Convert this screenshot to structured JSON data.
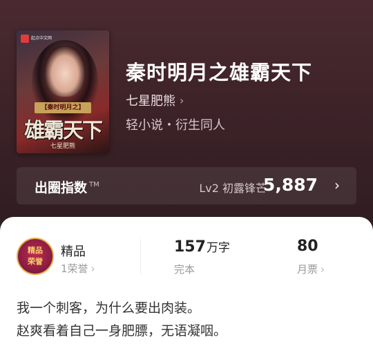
{
  "book": {
    "title": "秦时明月之雄霸天下",
    "author": "七星肥熊",
    "genre": "轻小说・衍生同人",
    "cover": {
      "publisher": "起点中文网",
      "subtitle": "【秦时明月之】",
      "big_title": "雄霸天下",
      "author": "七星肥熊"
    }
  },
  "index": {
    "label": "出圈指数",
    "tm": "TM",
    "level": "Lv2 初露锋芒",
    "value": "5,887"
  },
  "stats": {
    "badge_line1": "精品",
    "badge_line2": "荣誉",
    "tier": "精品",
    "honors": "1荣誉",
    "word_count": "157",
    "word_unit": "万字",
    "status": "完本",
    "monthly_tickets": "80",
    "monthly_tickets_label": "月票"
  },
  "blurb": {
    "line1": "我一个刺客，为什么要出肉装。",
    "line2": "赵爽看着自己一身肥膘，无语凝咽。"
  },
  "icons": {
    "chevron": "chevron-right-icon"
  }
}
